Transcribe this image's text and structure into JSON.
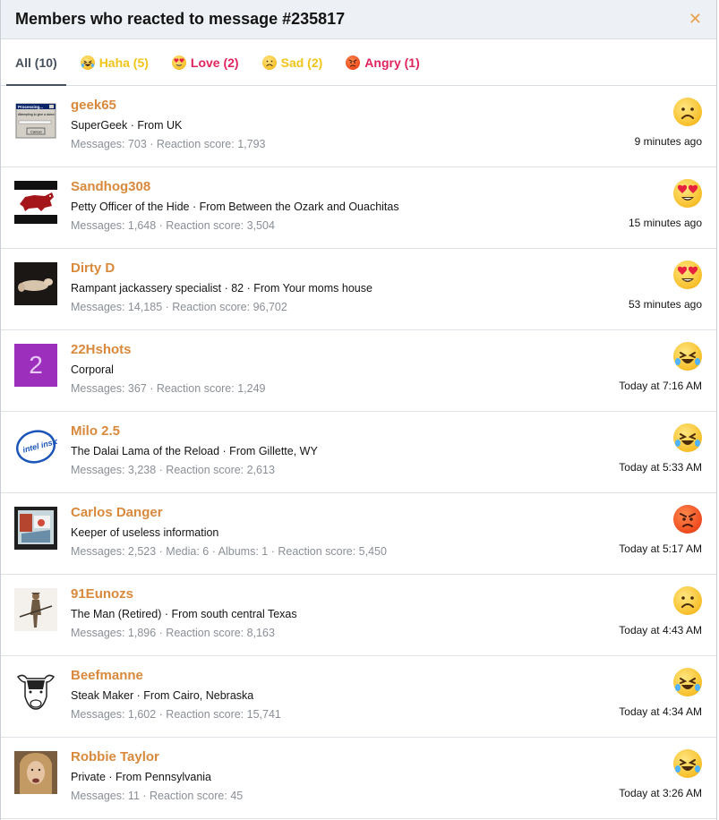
{
  "dialog": {
    "title": "Members who reacted to message #235817",
    "close_icon": "close-icon"
  },
  "tabs": [
    {
      "label": "All (10)",
      "icon": null
    },
    {
      "label": "Haha (5)",
      "icon": "haha-icon"
    },
    {
      "label": "Love (2)",
      "icon": "love-icon"
    },
    {
      "label": "Sad (2)",
      "icon": "sad-icon"
    },
    {
      "label": "Angry (1)",
      "icon": "angry-icon"
    }
  ],
  "members": [
    {
      "name": "geek65",
      "sub": "SuperGeek · From UK",
      "stats": "Messages: 703 · Reaction score: 1,793",
      "reaction": "sad",
      "time": "9 minutes ago"
    },
    {
      "name": "Sandhog308",
      "sub": "Petty Officer of the Hide · From Between the Ozark and Ouachitas",
      "stats": "Messages: 1,648 · Reaction score: 3,504",
      "reaction": "love",
      "time": "15 minutes ago"
    },
    {
      "name": "Dirty D",
      "sub": "Rampant jackassery specialist · 82 · From Your moms house",
      "stats": "Messages: 14,185 · Reaction score: 96,702",
      "reaction": "love",
      "time": "53 minutes ago"
    },
    {
      "name": "22Hshots",
      "sub": "Corporal",
      "stats": "Messages: 367 · Reaction score: 1,249",
      "reaction": "haha",
      "time": "Today at 7:16 AM",
      "avatar_letter": "2"
    },
    {
      "name": "Milo 2.5",
      "sub": "The Dalai Lama of the Reload · From Gillette, WY",
      "stats": "Messages: 3,238 · Reaction score: 2,613",
      "reaction": "haha",
      "time": "Today at 5:33 AM"
    },
    {
      "name": "Carlos Danger",
      "sub": "Keeper of useless information",
      "stats": "Messages: 2,523 · Media: 6 · Albums: 1 · Reaction score: 5,450",
      "reaction": "angry",
      "time": "Today at 5:17 AM"
    },
    {
      "name": "91Eunozs",
      "sub": "The Man (Retired) · From south central Texas",
      "stats": "Messages: 1,896 · Reaction score: 8,163",
      "reaction": "sad",
      "time": "Today at 4:43 AM"
    },
    {
      "name": "Beefmanne",
      "sub": "Steak Maker · From Cairo, Nebraska",
      "stats": "Messages: 1,602 · Reaction score: 15,741",
      "reaction": "haha",
      "time": "Today at 4:34 AM"
    },
    {
      "name": "Robbie Taylor",
      "sub": "Private · From Pennsylvania",
      "stats": "Messages: 11 · Reaction score: 45",
      "reaction": "haha",
      "time": "Today at 3:26 AM"
    }
  ],
  "avatar_text": {
    "geek65_dialog_title": "Processing...",
    "geek65_dialog_text": "Attempting to give a damn",
    "geek65_dialog_button": "Cancel",
    "milo_logo": "intel inside"
  },
  "colors": {
    "accent": "#d9893b",
    "header_bg": "#edf0f4",
    "haha": "#f0c419",
    "love": "#e0245e",
    "angry": "#e0245e"
  }
}
